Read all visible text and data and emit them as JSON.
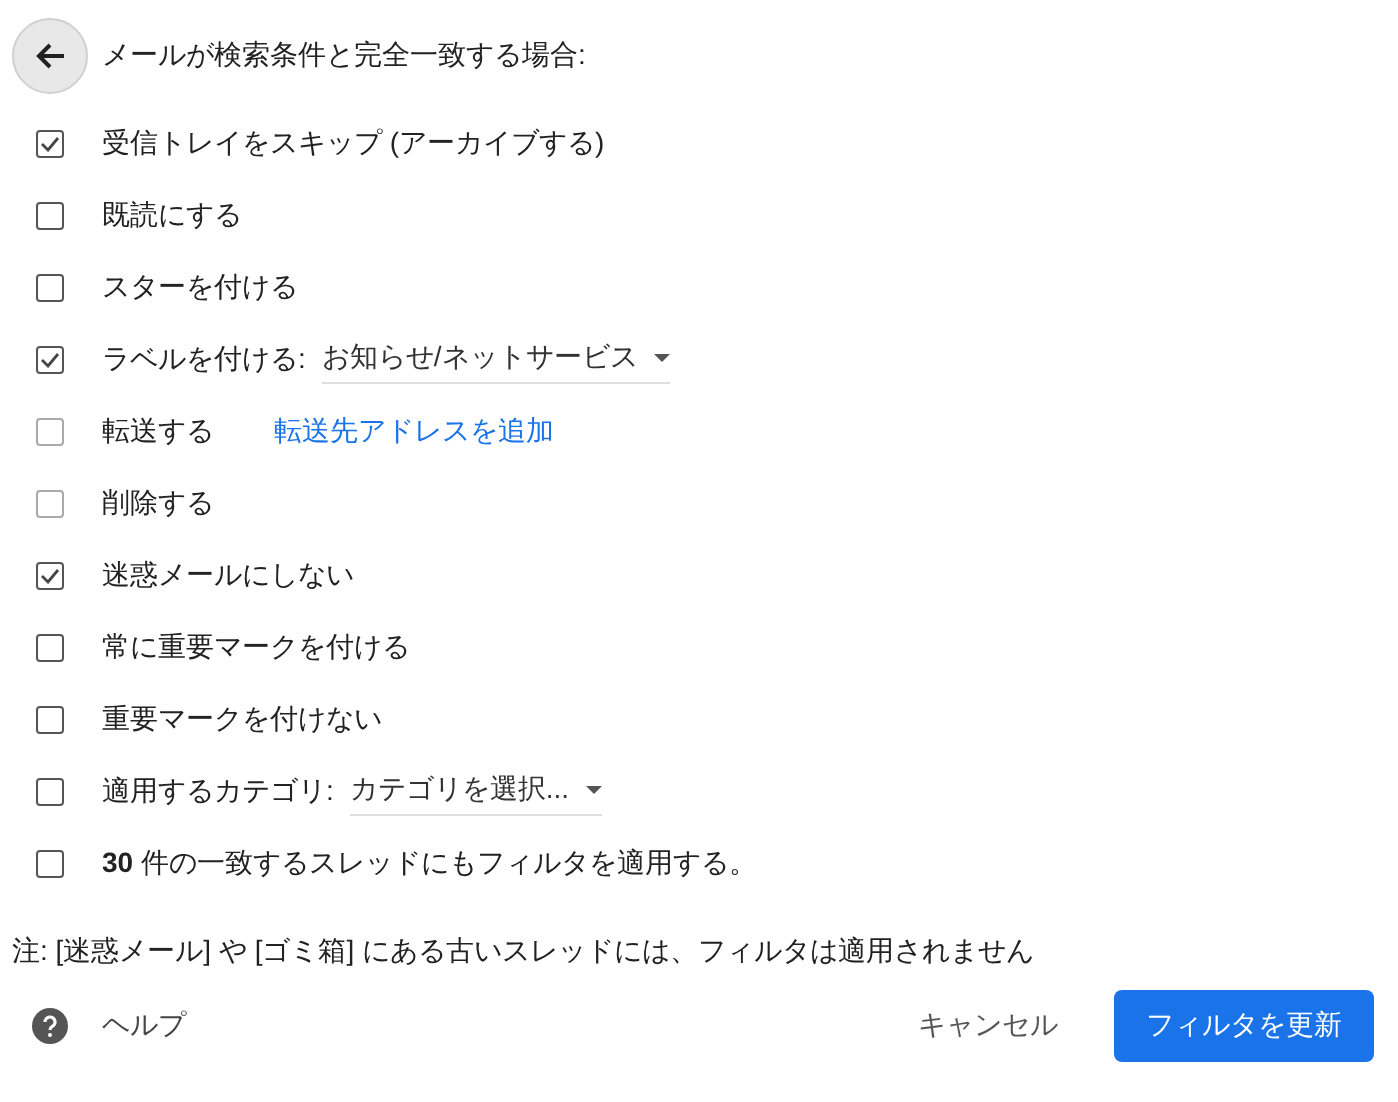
{
  "title": "メールが検索条件と完全一致する場合:",
  "options": [
    {
      "kind": "plain",
      "label": "受信トレイをスキップ (アーカイブする)",
      "checked": true,
      "disabled": false
    },
    {
      "kind": "plain",
      "label": "既読にする",
      "checked": false,
      "disabled": false
    },
    {
      "kind": "plain",
      "label": "スターを付ける",
      "checked": false,
      "disabled": false
    },
    {
      "kind": "dropdown",
      "label": "ラベルを付ける:",
      "value": "お知らせ/ネットサービス",
      "checked": true,
      "disabled": false
    },
    {
      "kind": "link",
      "label": "転送する",
      "link": "転送先アドレスを追加",
      "checked": false,
      "disabled": true
    },
    {
      "kind": "plain",
      "label": "削除する",
      "checked": false,
      "disabled": true
    },
    {
      "kind": "plain",
      "label": "迷惑メールにしない",
      "checked": true,
      "disabled": false
    },
    {
      "kind": "plain",
      "label": "常に重要マークを付ける",
      "checked": false,
      "disabled": false
    },
    {
      "kind": "plain",
      "label": "重要マークを付けない",
      "checked": false,
      "disabled": false
    },
    {
      "kind": "dropdown",
      "label": "適用するカテゴリ:",
      "value": "カテゴリを選択...",
      "checked": false,
      "disabled": false
    },
    {
      "kind": "plain",
      "label": "**30** 件の一致するスレッドにもフィルタを適用する。",
      "checked": false,
      "disabled": false
    }
  ],
  "note": "注: [迷惑メール] や [ゴミ箱] にある古いスレッドには、フィルタは適用されません",
  "help": "ヘルプ",
  "buttons": [
    {
      "kind": "text",
      "label": "キャンセル"
    },
    {
      "kind": "primary",
      "label": "フィルタを更新"
    }
  ]
}
